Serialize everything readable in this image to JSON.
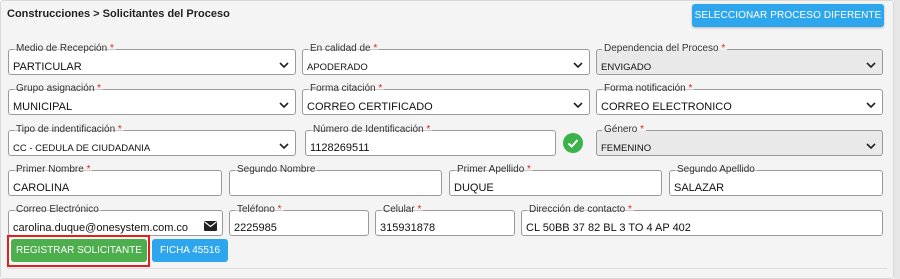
{
  "header": {
    "breadcrumb": "Construcciones > Solicitantes del Proceso",
    "change_process_label": "SELECCIONAR PROCESO DIFERENTE"
  },
  "required_marker": "*",
  "form": {
    "medio_recepcion": {
      "label": "Medio de Recepción",
      "value": "PARTICULAR"
    },
    "en_calidad_de": {
      "label": "En calidad de",
      "value": "APODERADO"
    },
    "dependencia": {
      "label": "Dependencia del Proceso",
      "value": "ENVIGADO"
    },
    "grupo_asignacion": {
      "label": "Grupo asignación",
      "value": "MUNICIPAL"
    },
    "forma_citacion": {
      "label": "Forma citación",
      "value": "CORREO CERTIFICADO"
    },
    "forma_notificacion": {
      "label": "Forma notificación",
      "value": "CORREO ELECTRONICO"
    },
    "tipo_identificacion": {
      "label": "Tipo de indentificación",
      "value": "CC - CEDULA DE CIUDADANIA"
    },
    "numero_identificacion": {
      "label": "Número de Identificación",
      "value": "1128269511"
    },
    "genero": {
      "label": "Género",
      "value": "FEMENINO"
    },
    "primer_nombre": {
      "label": "Primer Nombre",
      "value": "CAROLINA"
    },
    "segundo_nombre": {
      "label": "Segundo Nombre",
      "value": ""
    },
    "primer_apellido": {
      "label": "Primer Apellido",
      "value": "DUQUE"
    },
    "segundo_apellido": {
      "label": "Segundo Apellido",
      "value": "SALAZAR"
    },
    "correo": {
      "label": "Correo Electrónico",
      "value": "carolina.duque@onesystem.com.co"
    },
    "telefono": {
      "label": "Teléfono",
      "value": "2225985"
    },
    "celular": {
      "label": "Celular",
      "value": "315931878"
    },
    "direccion": {
      "label": "Dirección de contacto",
      "value": "CL 50BB 37 82 BL 3 TO 4 AP 402"
    }
  },
  "actions": {
    "registrar_label": "REGISTRAR SOLICITANTE",
    "ficha_label": "FICHA 45516"
  },
  "colors": {
    "primary_blue": "#2ea6ee",
    "success_green": "#4cae4c",
    "required_red": "#dd2222",
    "highlight_red": "#e02020"
  },
  "icons": [
    "chevron-down-icon",
    "check-circle-icon",
    "envelope-icon"
  ]
}
